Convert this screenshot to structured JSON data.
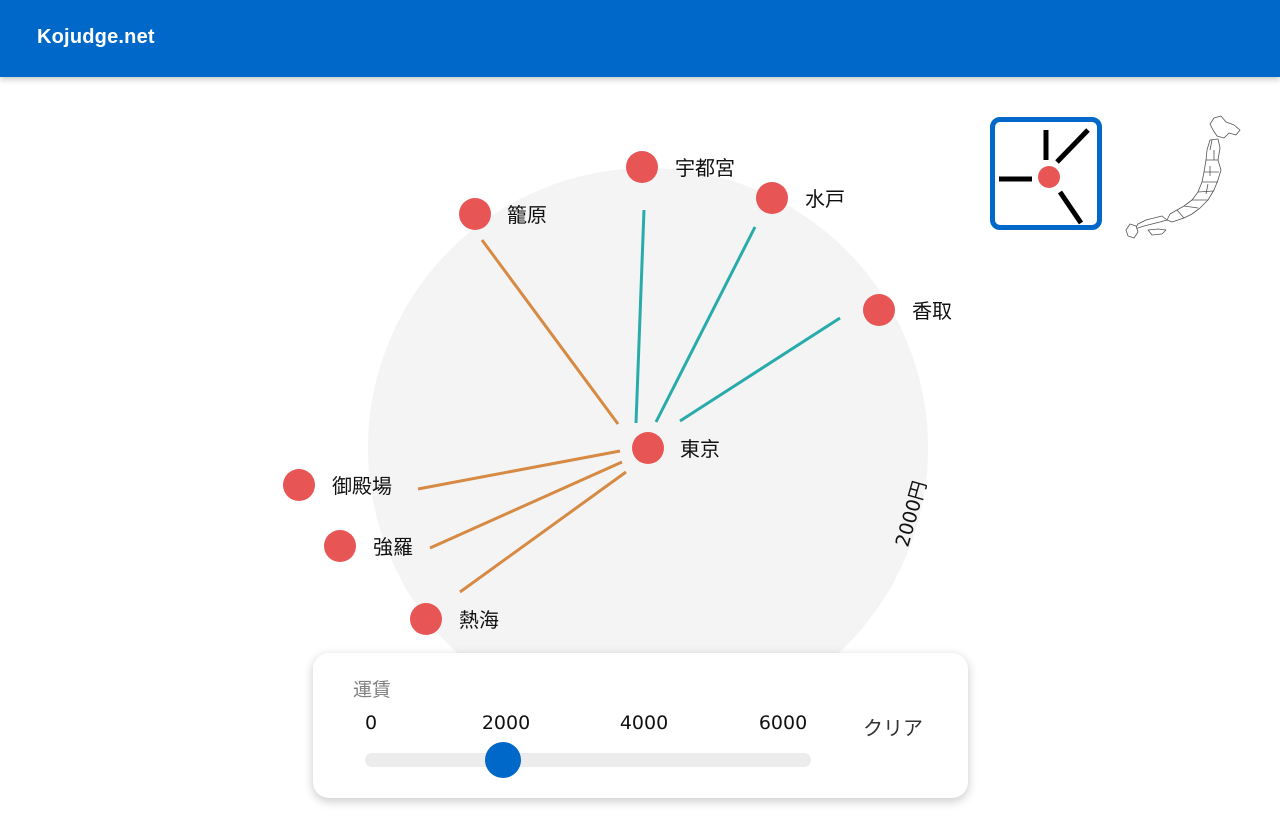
{
  "header": {
    "site_title": "Kojudge.net"
  },
  "map": {
    "radius_label": "2000円",
    "origin": {
      "name": "東京"
    },
    "stations": [
      {
        "name": "宇都宮"
      },
      {
        "name": "水戸"
      },
      {
        "name": "籠原"
      },
      {
        "name": "香取"
      },
      {
        "name": "御殿場"
      },
      {
        "name": "強羅"
      },
      {
        "name": "熱海"
      }
    ]
  },
  "fare_panel": {
    "title": "運賃",
    "ticks": [
      "0",
      "2000",
      "4000",
      "6000"
    ],
    "clear_label": "クリア",
    "slider_value": 2000,
    "slider_min": 0,
    "slider_max": 6000
  },
  "colors": {
    "header": "#0068c8",
    "station": "#e85555",
    "route_north": "#2aabab",
    "route_south": "#d68a43",
    "circle": "#f4f4f4",
    "accent": "#0068c8"
  },
  "icons": {
    "mode_toggle": "radial-lines-icon",
    "region_map": "japan-map-icon"
  }
}
